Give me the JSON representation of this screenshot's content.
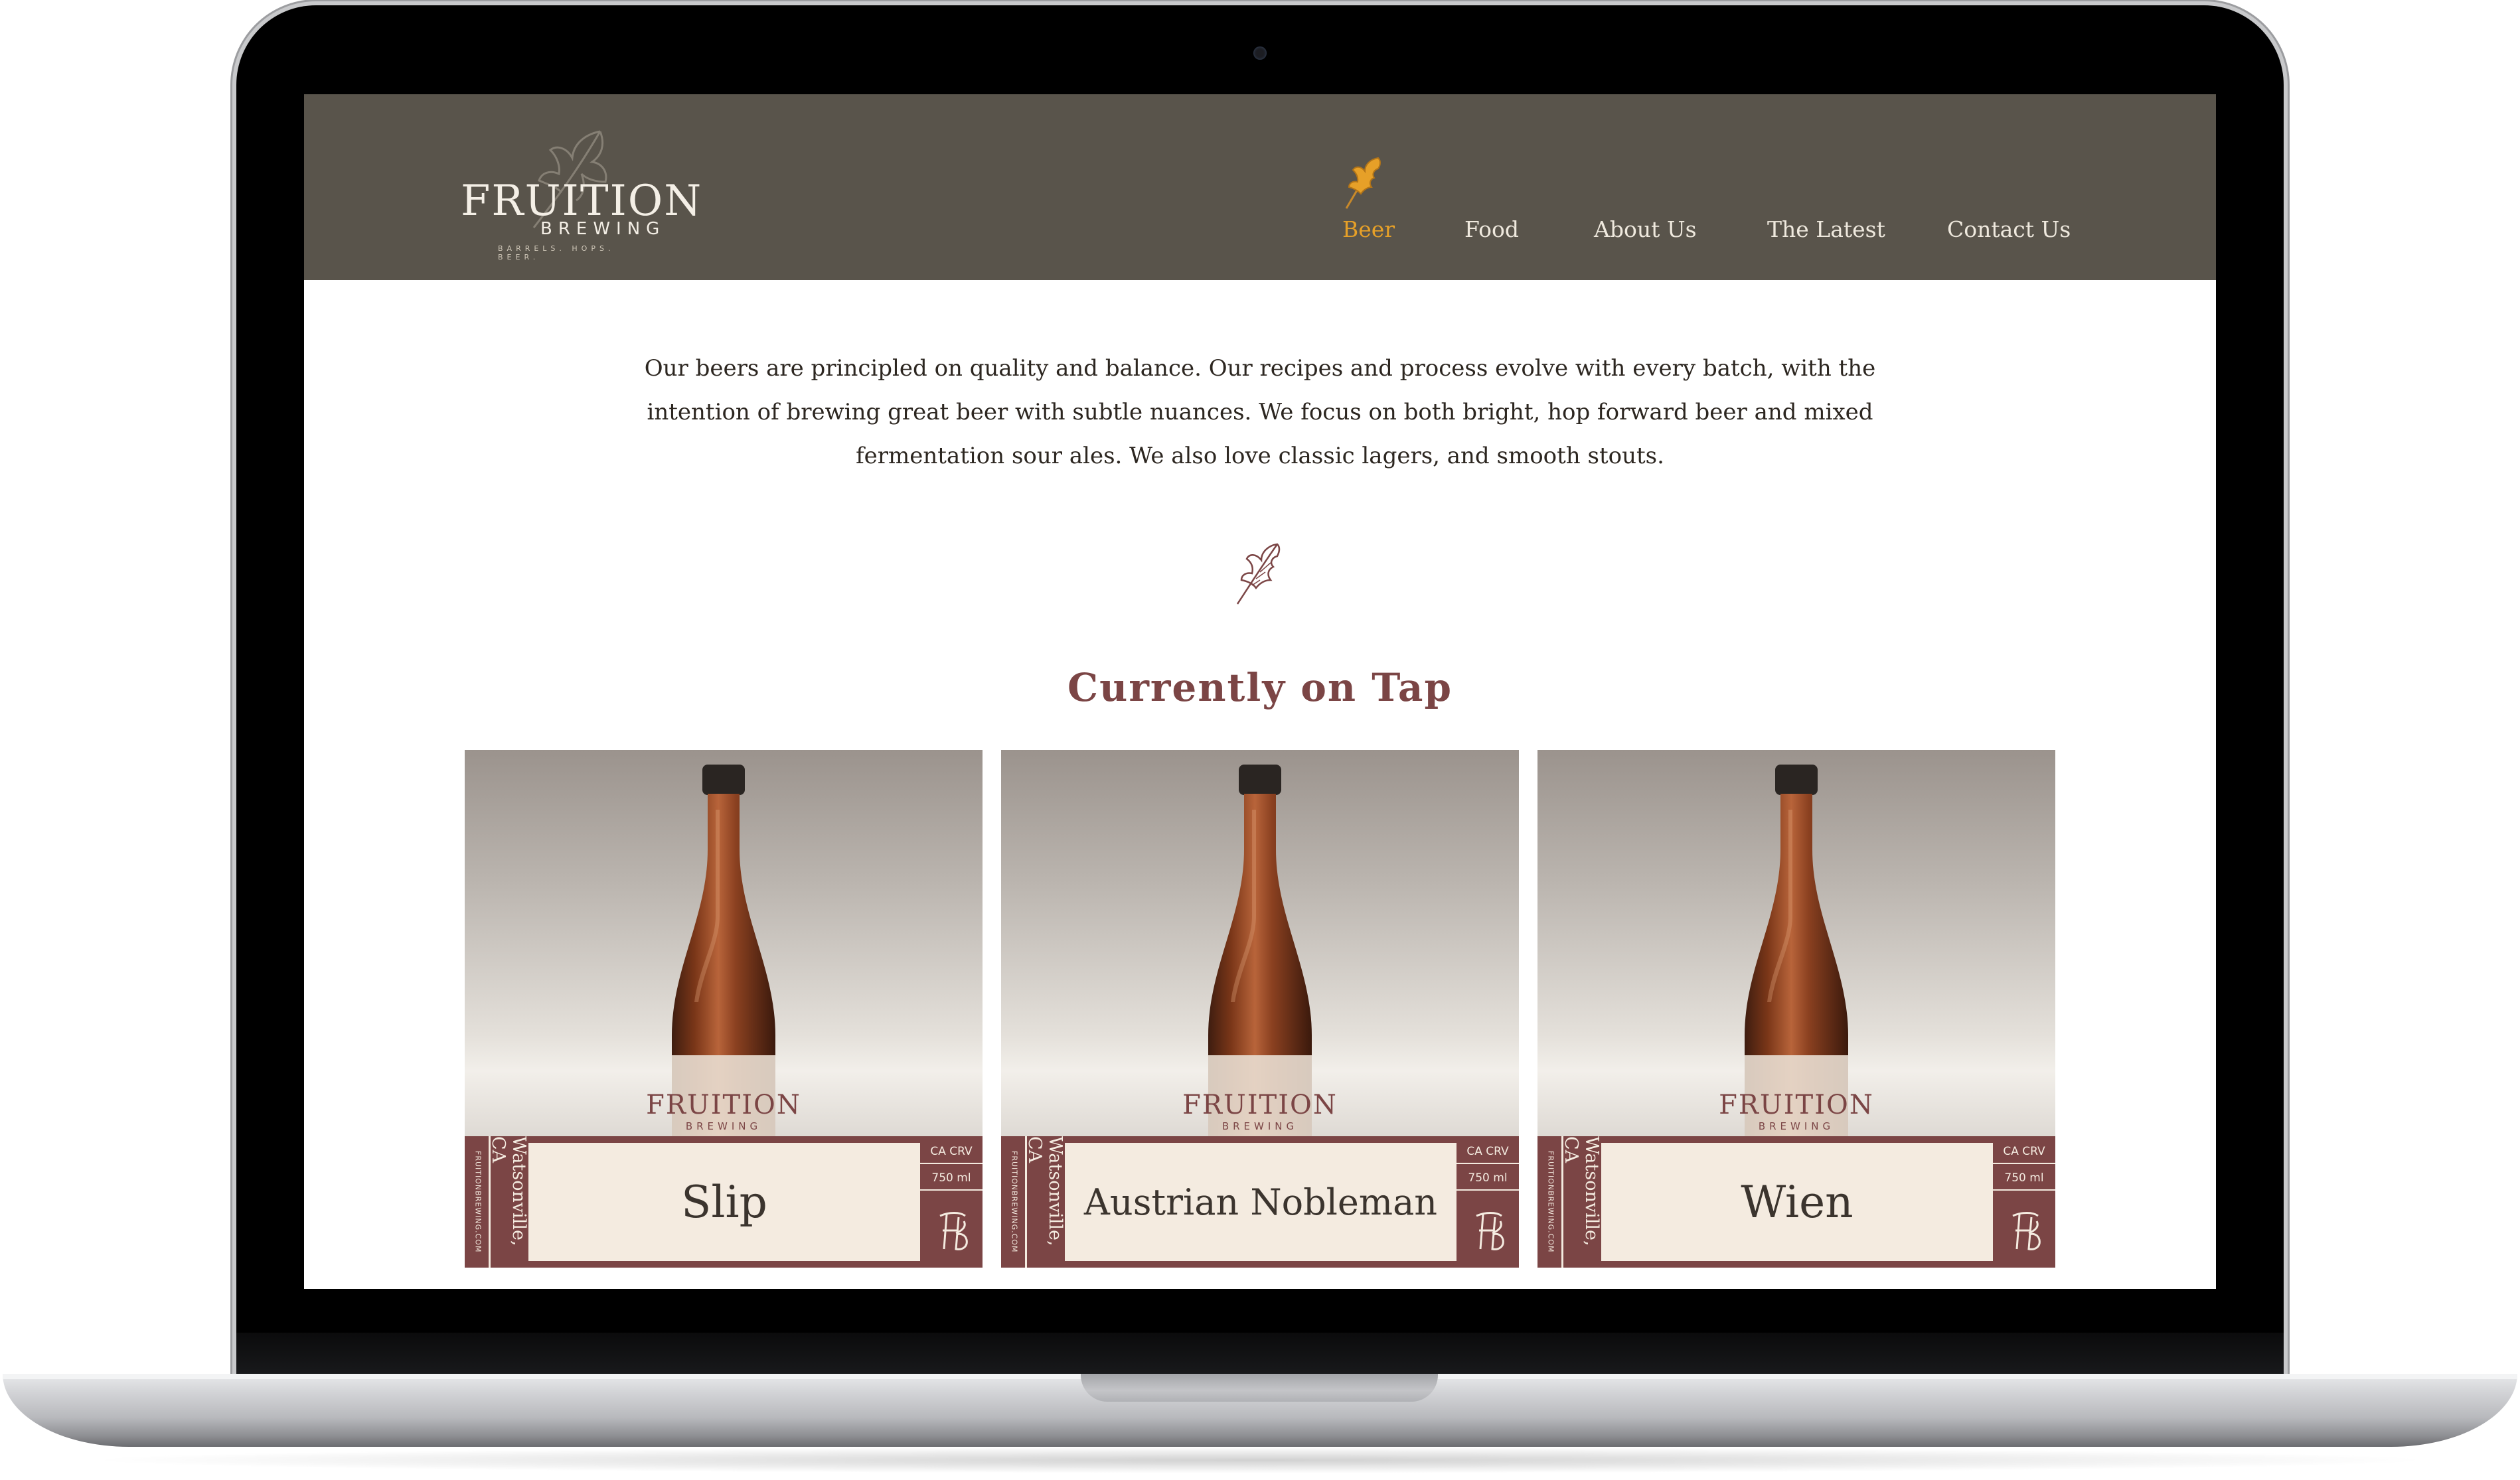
{
  "site": {
    "logo_word": "FRUITION",
    "logo_sub": "BREWING",
    "logo_tagline": "BARRELS. HOPS. BEER."
  },
  "nav": {
    "items": [
      {
        "label": "Beer",
        "active": true
      },
      {
        "label": "Food",
        "active": false
      },
      {
        "label": "About Us",
        "active": false
      },
      {
        "label": "The Latest",
        "active": false
      },
      {
        "label": "Contact Us",
        "active": false
      }
    ]
  },
  "intro": {
    "text": "Our beers are principled on quality and balance. Our recipes and process evolve with every batch, with the intention of brewing great beer with subtle nuances. We focus on both bright, hop forward beer and mixed fermentation sour ales. We also love classic lagers, and smooth stouts."
  },
  "section": {
    "title": "Currently on Tap"
  },
  "beers": [
    {
      "name": "Slip",
      "city": "Watsonville, CA",
      "url": "FRUITIONBREWING.COM",
      "crv": "CA CRV",
      "volume": "750 ml",
      "bottle_logo": "FRUITION",
      "bottle_logo_sub": "BREWING"
    },
    {
      "name": "Austrian Nobleman",
      "city": "Watsonville, CA",
      "url": "FRUITIONBREWING.COM",
      "crv": "CA CRV",
      "volume": "750 ml",
      "bottle_logo": "FRUITION",
      "bottle_logo_sub": "BREWING"
    },
    {
      "name": "Wien",
      "city": "Watsonville, CA",
      "url": "FRUITIONBREWING.COM",
      "crv": "CA CRV",
      "volume": "750 ml",
      "bottle_logo": "FRUITION",
      "bottle_logo_sub": "BREWING"
    }
  ],
  "colors": {
    "header_bg": "#59544b",
    "accent_active": "#e6a028",
    "brand_maroon": "#7b4545",
    "label_cream": "#f4ebe0"
  },
  "icons": {
    "nav_active_marker": "oak-leaf-icon",
    "divider": "oak-leaf-icon",
    "label_monogram": "fb-monogram-icon"
  }
}
